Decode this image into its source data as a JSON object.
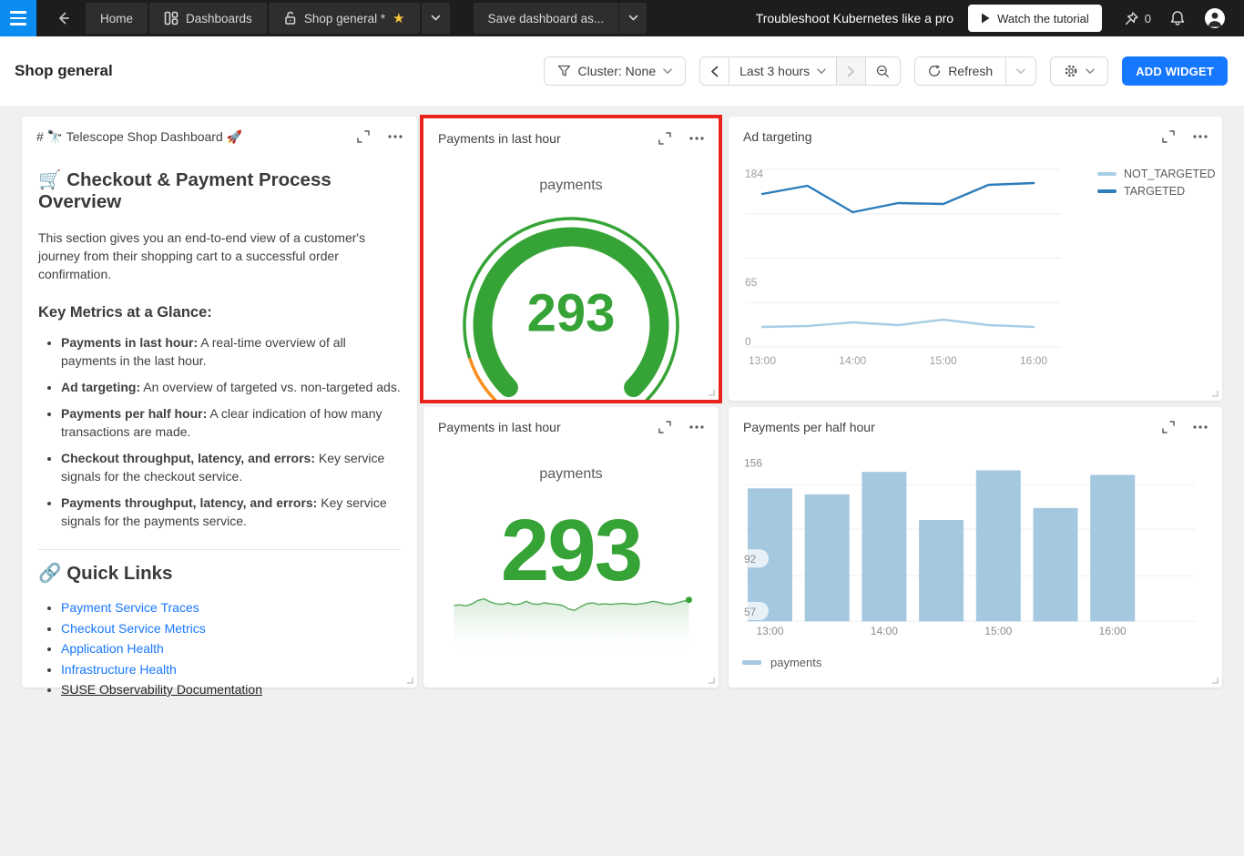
{
  "topbar": {
    "tabs": [
      {
        "label": "Home"
      },
      {
        "label": "Dashboards"
      },
      {
        "label": "Shop general *"
      }
    ],
    "save_button": "Save dashboard as...",
    "promo_text": "Troubleshoot Kubernetes like a pro",
    "tutorial_button": "Watch the tutorial",
    "pin_count": "0"
  },
  "header": {
    "title": "Shop general",
    "cluster_filter": "Cluster: None",
    "time_range": "Last 3 hours",
    "refresh_label": "Refresh",
    "add_widget": "ADD WIDGET"
  },
  "widgets": {
    "markdown": {
      "title": "# 🔭 Telescope Shop Dashboard 🚀",
      "heading1": "🛒 Checkout & Payment Process Overview",
      "intro": "This section gives you an end-to-end view of a customer's journey from their shopping cart to a successful order confirmation.",
      "heading2": "Key Metrics at a Glance:",
      "metrics": [
        {
          "label": "Payments in last hour:",
          "text": "A real-time overview of all payments in the last hour."
        },
        {
          "label": "Ad targeting:",
          "text": "An overview of targeted vs. non-targeted ads."
        },
        {
          "label": "Payments per half hour:",
          "text": "A clear indication of how many transactions are made."
        },
        {
          "label": "Checkout throughput, latency, and errors:",
          "text": "Key service signals for the checkout service."
        },
        {
          "label": "Payments throughput, latency, and errors:",
          "text": "Key service signals for the payments service."
        }
      ],
      "links_heading": "🔗 Quick Links",
      "links": [
        {
          "label": "Payment Service Traces"
        },
        {
          "label": "Checkout Service Metrics"
        },
        {
          "label": "Application Health"
        },
        {
          "label": "Infrastructure Health"
        },
        {
          "label": "SUSE Observability Documentation"
        }
      ]
    },
    "gauge": {
      "title": "Payments in last hour"
    },
    "ad_targeting": {
      "title": "Ad targeting"
    },
    "payments_number": {
      "title": "Payments in last hour"
    },
    "bar": {
      "title": "Payments per half hour"
    }
  },
  "chart_data": [
    {
      "id": "payments-gauge",
      "type": "gauge",
      "title": "Payments in last hour",
      "metric": "payments",
      "value": 293,
      "main_color": "#36a336",
      "low_segment_color": "#f98f20",
      "low_segment_fraction": 0.1,
      "progress_fraction": 1.0
    },
    {
      "id": "ad-targeting",
      "type": "line",
      "title": "Ad targeting",
      "x": [
        "13:00",
        "13:30",
        "14:00",
        "14:30",
        "15:00",
        "15:30",
        "16:00"
      ],
      "x_ticks": [
        "13:00",
        "14:00",
        "15:00",
        "16:00"
      ],
      "y_ticks": [
        184,
        65,
        0
      ],
      "ylim": [
        0,
        196
      ],
      "grid": true,
      "legend_position": "right",
      "series": [
        {
          "name": "NOT_TARGETED",
          "color": "#a8cee6",
          "values": [
            16,
            17,
            21,
            18,
            24,
            18,
            16
          ]
        },
        {
          "name": "TARGETED",
          "color": "#2d7dbb",
          "values": [
            162,
            171,
            142,
            152,
            151,
            172,
            174
          ]
        }
      ]
    },
    {
      "id": "payments-number",
      "type": "number+sparkline",
      "title": "Payments in last hour",
      "metric": "payments",
      "value": 293,
      "color": "#36a336",
      "sparkline_color": "#57a95c",
      "sparkline": [
        55,
        56,
        54,
        58,
        65,
        68,
        62,
        58,
        57,
        60,
        56,
        58,
        63,
        58,
        57,
        60,
        58,
        57,
        55,
        48,
        45,
        52,
        58,
        60,
        57,
        58,
        57,
        58,
        59,
        58,
        57,
        58,
        60,
        63,
        61,
        58,
        57,
        60,
        63,
        66
      ]
    },
    {
      "id": "payments-per-half-hour",
      "type": "bar",
      "title": "Payments per half hour",
      "categories": [
        "13:00",
        "13:30",
        "14:00",
        "14:30",
        "15:00",
        "15:30",
        "16:00"
      ],
      "x_ticks": [
        "13:00",
        "14:00",
        "15:00",
        "16:00"
      ],
      "values": [
        138,
        134,
        149,
        117,
        150,
        125,
        147
      ],
      "y_ticks": [
        156,
        92,
        57
      ],
      "ylim": [
        50,
        160
      ],
      "color": "#a5c8e1",
      "legend": "payments",
      "legend_position": "bottom"
    }
  ]
}
